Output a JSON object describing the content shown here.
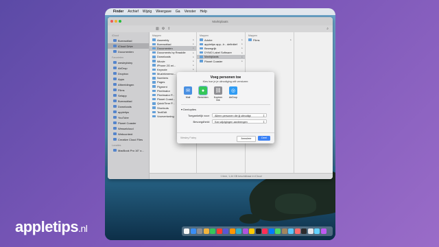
{
  "menubar": {
    "apple": "",
    "items": [
      "Finder",
      "Archief",
      "Wijzig",
      "Weergave",
      "Ga",
      "Venster",
      "Help"
    ]
  },
  "window": {
    "title": "Marktplaats"
  },
  "sidebar": {
    "sections": [
      {
        "heading": "iCloud",
        "items": [
          "Bureaublad",
          "iCloud Drive",
          "Documenten"
        ],
        "selected": 1
      },
      {
        "heading": "Favorieten",
        "items": [
          "wesleyfabry",
          "AirDrop",
          "Dropbox",
          "Apps",
          "Afbeeldingen",
          "Films",
          "Setapp",
          "Bureaublad",
          "Downloads",
          "appletips",
          "YouTube",
          "Planet Coaster",
          "Wesselcloud",
          "Webcontent",
          "Creative Cloud Files"
        ]
      },
      {
        "heading": "Locaties",
        "items": [
          "MacBook Pro 16\" o..."
        ]
      }
    ]
  },
  "columns": [
    {
      "head": "Mappen",
      "rows": [
        "Assembly",
        "Bureaublad",
        "Documenten",
        "Documents by Readdle",
        "Downloads",
        "iMovie",
        "iPhone 2G wi...",
        "Keynote",
        "Muziekmemo...",
        "Numbers",
        "Pages",
        "Pigment",
        "Pixelmator",
        "Pixelmator P...",
        "Planet Coast...",
        "QuickTime P...",
        "Shortcuts",
        "TextEdit",
        "Voorvertoning"
      ],
      "selected": 2
    },
    {
      "head": "Mappen",
      "rows": [
        "Adobe",
        "appletips app...b - definitief",
        "Bewegrijk",
        "DYMO Label Software",
        "Marktplaats",
        "Planet Coaster"
      ],
      "selected": 4
    },
    {
      "head": "Mappen",
      "rows": [
        "Films"
      ],
      "selected": -1
    }
  ],
  "statusbar": "1 item, 1,44 GB beschikbaar in iCloud",
  "sheet": {
    "title": "Voeg personen toe",
    "subtitle": "Kies hoe je je uitnodiging wilt versturen:",
    "shares": [
      {
        "label": "Mail",
        "icon": "mail-icon",
        "color": "#4a90e2"
      },
      {
        "label": "Berichten",
        "icon": "messages-icon",
        "color": "#34c759"
      },
      {
        "label": "Kopieer link",
        "icon": "link-icon",
        "color": "#8e8e93"
      },
      {
        "label": "AirDrop",
        "icon": "airdrop-icon",
        "color": "#2f9cf4"
      }
    ],
    "selected_share": 1,
    "options_title": "Deelopties",
    "access_label": "Toegankelijk voor:",
    "access_value": "Alleen personen die jij uitnodigt",
    "permission_label": "Bevoegdheid:",
    "permission_value": "Kan wijzigingen aanbrengen",
    "owner": "Wesley Fabry",
    "cancel": "Annuleer",
    "share": "Deel"
  },
  "brand": {
    "name": "appletips",
    "tld": ".nl"
  }
}
